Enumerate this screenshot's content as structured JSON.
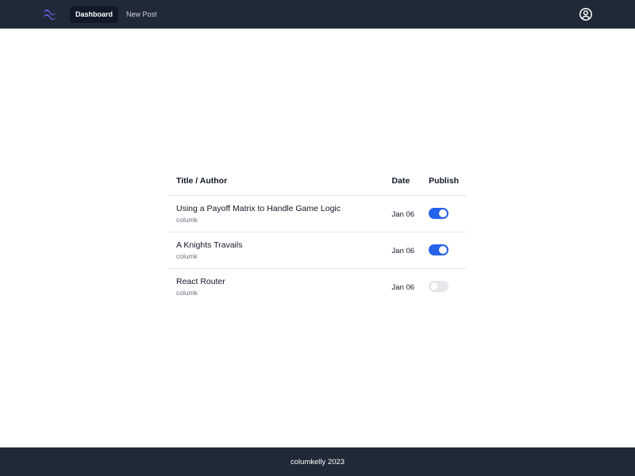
{
  "navbar": {
    "logo_icon": "tailwind-wave-logo",
    "links": [
      {
        "label": "Dashboard",
        "active": true
      },
      {
        "label": "New Post",
        "active": false
      }
    ],
    "user_icon": "user-circle-icon"
  },
  "table": {
    "headers": {
      "title_author": "Title / Author",
      "date": "Date",
      "publish": "Publish"
    },
    "rows": [
      {
        "title": "Using a Payoff Matrix to Handle Game Logic",
        "author": "columk",
        "date": "Jan 06",
        "published": true
      },
      {
        "title": "A Knights Travails",
        "author": "columk",
        "date": "Jan 06",
        "published": true
      },
      {
        "title": "React Router",
        "author": "columk",
        "date": "Jan 06",
        "published": false
      }
    ]
  },
  "footer": {
    "text": "columkelly 2023"
  },
  "colors": {
    "navbar_bg": "#1f2937",
    "toggle_on": "#2563eb",
    "toggle_off": "#e5e7eb",
    "logo_accent": "#6366f1"
  }
}
